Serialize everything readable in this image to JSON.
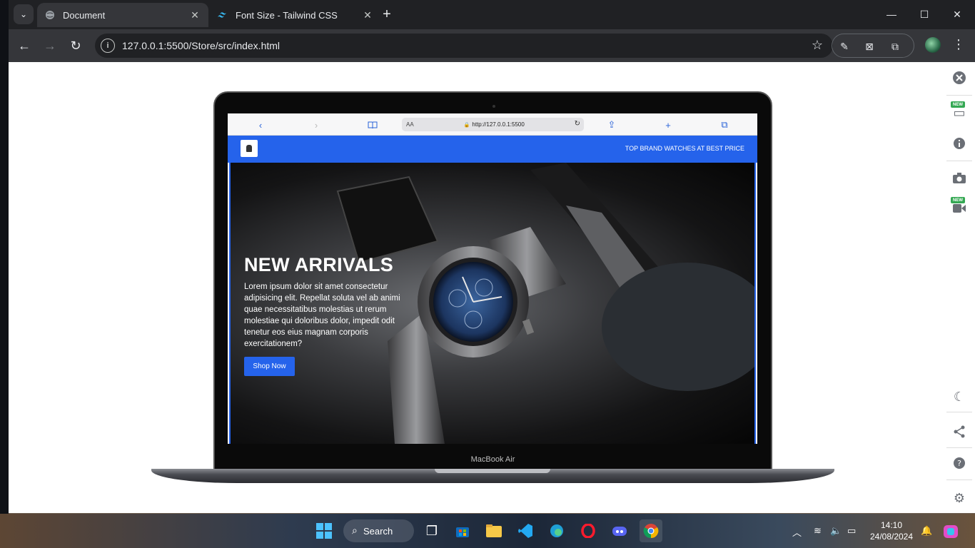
{
  "tabs": [
    {
      "title": "Document",
      "icon": "globe-icon"
    },
    {
      "title": "Font Size - Tailwind CSS",
      "icon": "tailwind-icon"
    }
  ],
  "omnibox": {
    "url": "127.0.0.1:5500/Store/src/index.html"
  },
  "safari": {
    "aa": "AA",
    "url": "http://127.0.0.1:5500"
  },
  "site": {
    "tagline": "TOP BRAND WATCHES AT BEST PRICE",
    "hero": {
      "title": "NEW ARRIVALS",
      "text": "Lorem ipsum dolor sit amet consectetur adipisicing elit. Repellat soluta vel ab animi quae necessitatibus molestias ut rerum molestiae qui doloribus dolor, impedit odit tenetur eos eius magnam corporis exercitationem?",
      "button": "Shop Now"
    }
  },
  "device": {
    "label": "MacBook Air"
  },
  "taskbar": {
    "search": "Search",
    "time": "14:10",
    "date": "24/08/2024"
  },
  "colors": {
    "accent": "#2563eb",
    "chrome_bg": "#202124",
    "toolbar_bg": "#35363a"
  }
}
